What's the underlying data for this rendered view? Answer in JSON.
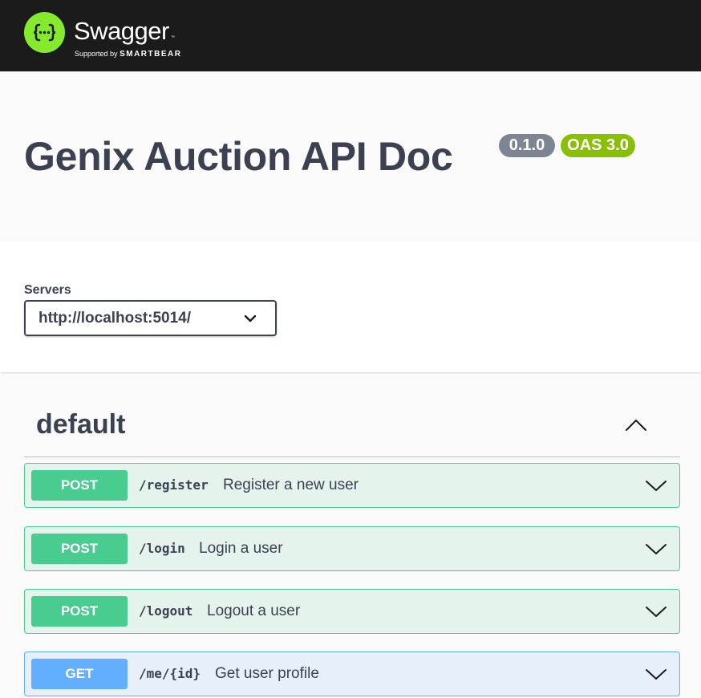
{
  "topbar": {
    "brand": "Swagger",
    "trademark": "™",
    "supported_by": "Supported by",
    "company": "SMARTBEAR",
    "logo_icon": "curly-braces-icon",
    "colors": {
      "background": "#1b1b1b",
      "logo": "#85ea2d"
    }
  },
  "info": {
    "title": "Genix Auction API Doc",
    "version": "0.1.0",
    "spec": "OAS 3.0"
  },
  "servers": {
    "label": "Servers",
    "selected": "http://localhost:5014/"
  },
  "tag": {
    "name": "default",
    "toggle_icon": "chevron-up-icon"
  },
  "operations": [
    {
      "method": "POST",
      "path": "/register",
      "summary": "Register a new user"
    },
    {
      "method": "POST",
      "path": "/login",
      "summary": "Login a user"
    },
    {
      "method": "POST",
      "path": "/logout",
      "summary": "Logout a user"
    },
    {
      "method": "GET",
      "path": "/me/{id}",
      "summary": "Get user profile"
    }
  ],
  "colors": {
    "post": "#49cc90",
    "get": "#61affe",
    "version_badge": "#7d8492",
    "oas_badge": "#89bf04",
    "text": "#3b4151"
  }
}
